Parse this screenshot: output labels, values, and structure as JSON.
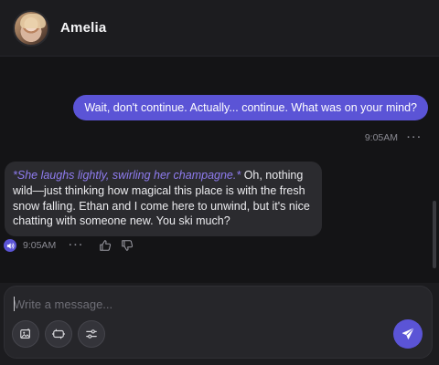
{
  "header": {
    "contact_name": "Amelia"
  },
  "messages": {
    "user": {
      "text": "Wait, don't continue. Actually... continue. What was on your mind?",
      "time": "9:05AM",
      "more": "···"
    },
    "bot": {
      "action": "*She laughs lightly, swirling her champagne.*",
      "text": " Oh, nothing wild—just thinking how magical this place is with the fresh snow falling. Ethan and I come here to unwind, but it's nice chatting with someone new. You ski much?",
      "time": "9:05AM",
      "more": "···"
    }
  },
  "composer": {
    "placeholder": "Write a message...",
    "value": ""
  },
  "colors": {
    "accent": "#5b54d6",
    "action_text": "#8f7cf0",
    "background": "#141416",
    "bubble_bot": "#2b2b2f"
  },
  "icons": {
    "speaker": "speaker-icon",
    "thumbs_up": "thumbs-up-icon",
    "thumbs_down": "thumbs-down-icon",
    "image_tool": "image-edit-icon",
    "reply_tool": "message-tag-icon",
    "settings_tool": "sliders-icon",
    "send": "send-icon"
  }
}
